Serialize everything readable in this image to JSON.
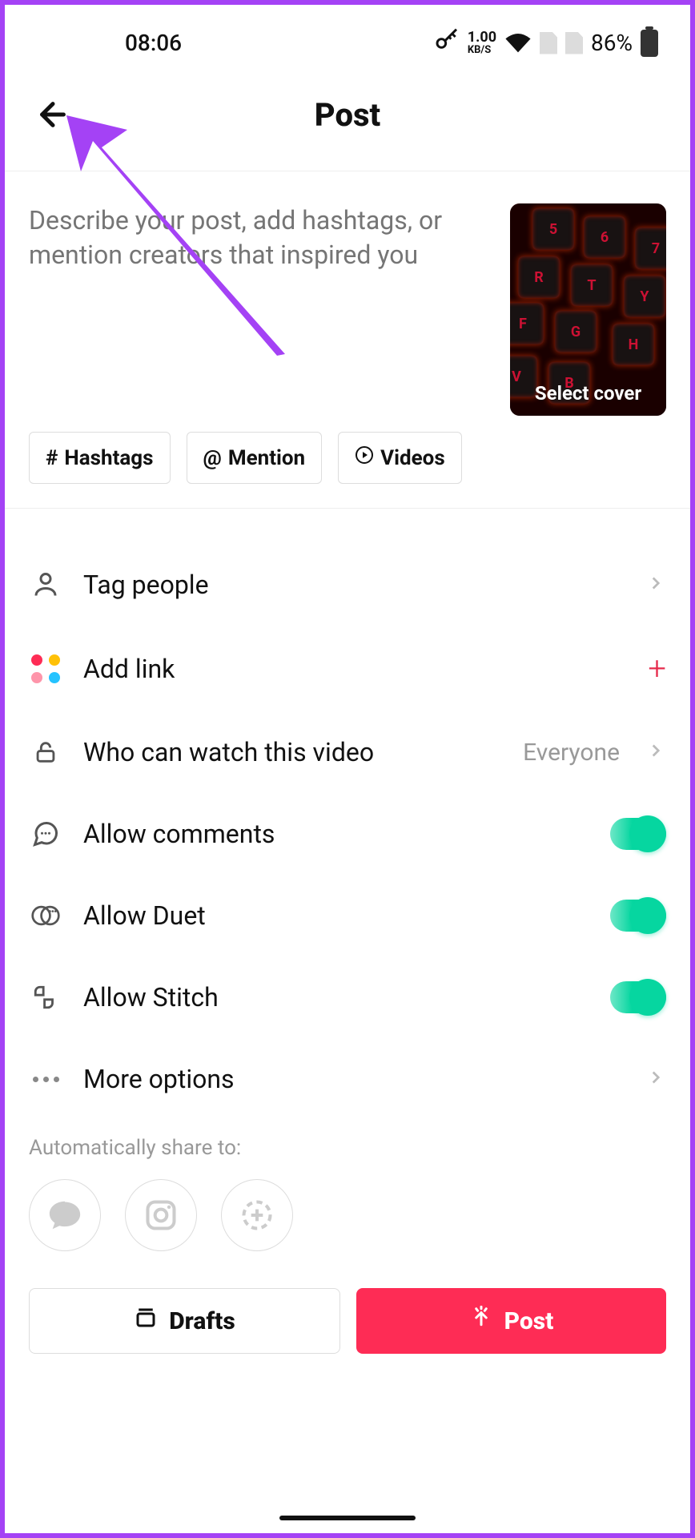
{
  "status": {
    "time": "08:06",
    "kbs_value": "1.00",
    "kbs_unit": "KB/S",
    "battery": "86%"
  },
  "header": {
    "title": "Post"
  },
  "caption": {
    "placeholder": "Describe your post, add hashtags, or mention creators that inspired you",
    "cover_label": "Select cover"
  },
  "chips": {
    "hashtags": "Hashtags",
    "mention": "Mention",
    "videos": "Videos"
  },
  "options": {
    "tag_people": "Tag people",
    "add_link": "Add link",
    "privacy": {
      "label": "Who can watch this video",
      "value": "Everyone"
    },
    "allow_comments": "Allow comments",
    "allow_duet": "Allow Duet",
    "allow_stitch": "Allow Stitch",
    "more_options": "More options"
  },
  "share": {
    "label": "Automatically share to:"
  },
  "buttons": {
    "drafts": "Drafts",
    "post": "Post"
  },
  "colors": {
    "accent": "#fe2c55",
    "toggleOn": "#06d6a0",
    "annotation": "#a442f5"
  }
}
